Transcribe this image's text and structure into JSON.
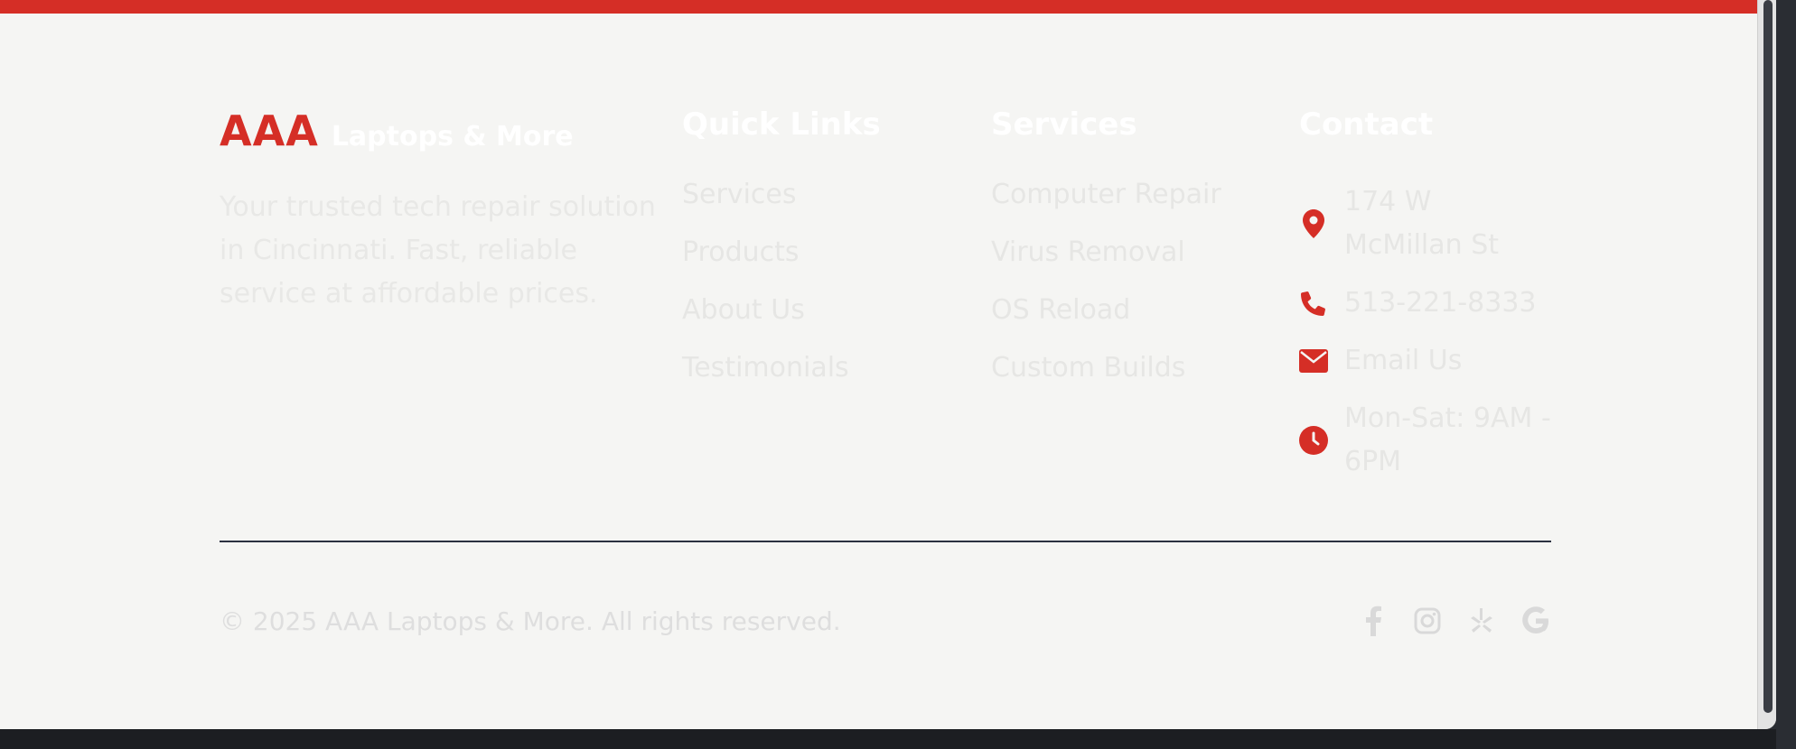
{
  "brand": {
    "mark": "AAA",
    "name": "Laptops & More",
    "tagline": "Your trusted tech repair solution in Cincinnati. Fast, reliable service at affordable prices."
  },
  "quick_links": {
    "title": "Quick Links",
    "items": [
      "Services",
      "Products",
      "About Us",
      "Testimonials"
    ]
  },
  "services": {
    "title": "Services",
    "items": [
      "Computer Repair",
      "Virus Removal",
      "OS Reload",
      "Custom Builds"
    ]
  },
  "contact": {
    "title": "Contact",
    "address_line1": "174 W",
    "address_line2": "McMillan St",
    "phone": "513-221-8333",
    "email_label": "Email Us",
    "hours_line1": "Mon-Sat: 9AM -",
    "hours_line2": "6PM",
    "icons": [
      "map-pin-icon",
      "phone-icon",
      "envelope-icon",
      "clock-icon"
    ]
  },
  "footer": {
    "copyright": "© 2025 AAA Laptops & More. All rights reserved.",
    "social_icons": [
      "facebook-icon",
      "instagram-icon",
      "yelp-icon",
      "google-icon"
    ]
  },
  "colors": {
    "accent": "#d52e26",
    "background": "#f5f5f3",
    "divider": "#2b3140"
  }
}
